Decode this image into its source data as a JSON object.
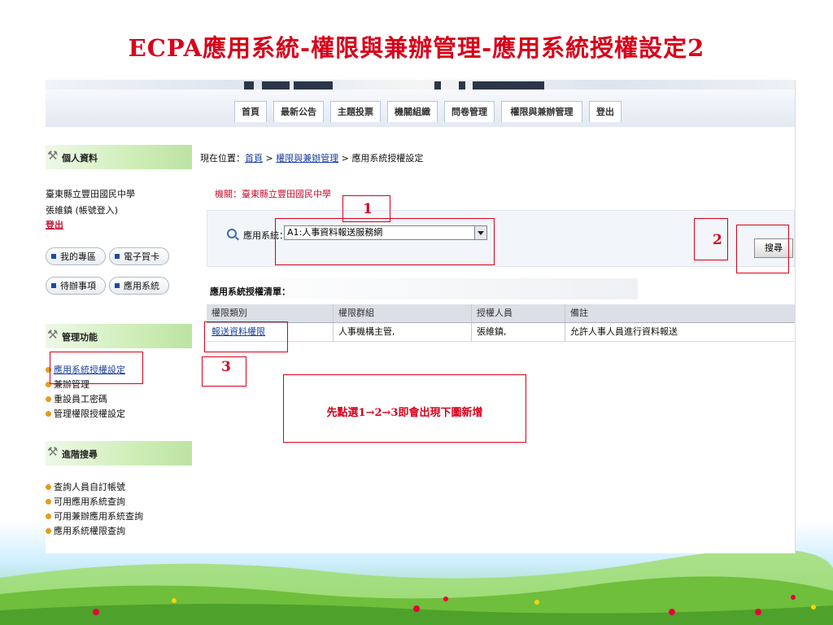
{
  "slide": {
    "title": "ECPA應用系統-權限與兼辦管理-應用系統授權設定2"
  },
  "nav": {
    "items": [
      "首頁",
      "最新公告",
      "主題投票",
      "機關組織",
      "問卷管理",
      "權限與兼辦管理",
      "登出"
    ]
  },
  "sidebar": {
    "personal": {
      "heading": "個人資料",
      "org": "臺東縣立豐田國民中學",
      "user": "張維鎮 (帳號登入)",
      "logout": "登出"
    },
    "pills": [
      "我的專區",
      "電子賀卡",
      "待辦事項",
      "應用系統"
    ],
    "admin": {
      "heading": "管理功能",
      "items": [
        "應用系統授權設定",
        "兼辦管理",
        "重設員工密碼",
        "管理權限授權設定"
      ]
    },
    "advanced": {
      "heading": "進階搜尋",
      "items": [
        "查詢人員自訂帳號",
        "可用應用系統查詢",
        "可用兼辦應用系統查詢",
        "應用系統權限查詢"
      ]
    }
  },
  "main": {
    "breadcrumb": {
      "prefix": "現在位置：",
      "home": "首頁",
      "sep": " > ",
      "section": "權限與兼辦管理",
      "current": "應用系統授權設定"
    },
    "agency": "機關：臺東縣立豐田國民中學",
    "search": {
      "label": "應用系統：",
      "selected": "A1:人事資料報送服務網",
      "button": "搜尋"
    },
    "list_title": "應用系統授權清單：",
    "table": {
      "headers": [
        "權限類別",
        "權限群組",
        "授權人員",
        "備註"
      ],
      "rows": [
        [
          "報送資料權限",
          "人事機構主管,",
          "張維鎮,",
          "允許人事人員進行資料報送"
        ]
      ]
    }
  },
  "annotations": {
    "step1": "1",
    "step2": "2",
    "step3": "3",
    "note": "先點選1→2→3即會出現下圖新增"
  },
  "colors": {
    "accent_red": "#d8001a",
    "link_blue": "#1a3f9e",
    "sidebar_green": "#cfeeb8"
  }
}
